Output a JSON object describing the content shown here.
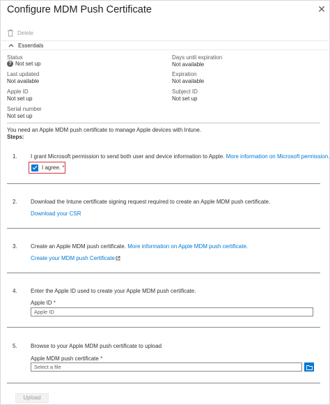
{
  "header": {
    "title": "Configure MDM Push Certificate",
    "close_glyph": "✕"
  },
  "toolbar": {
    "delete_label": "Delete"
  },
  "essentials": {
    "toggle_label": "Essentials",
    "status_label": "Status",
    "status_value": "Not set up",
    "last_updated_label": "Last updated",
    "last_updated_value": "Not available",
    "apple_id_label": "Apple ID",
    "apple_id_value": "Not set up",
    "serial_label": "Serial number",
    "serial_value": "Not set up",
    "days_label": "Days until expiration",
    "days_value": "Not available",
    "expiration_label": "Expiration",
    "expiration_value": "Not available",
    "subject_label": "Subject ID",
    "subject_value": "Not set up"
  },
  "intro": "You need an Apple MDM push certificate to manage Apple devices with Intune.",
  "steps_label": "Steps:",
  "steps": [
    {
      "num": "1.",
      "text": "I grant Microsoft permission to send both user and device information to Apple.",
      "link": "More information on Microsoft permission.",
      "agree_label": "I agree.",
      "required": "*"
    },
    {
      "num": "2.",
      "text": "Download the Intune certificate signing request required to create an Apple MDM push certificate.",
      "link": "Download your CSR"
    },
    {
      "num": "3.",
      "text": "Create an Apple MDM push certificate.",
      "link": "More information on Apple MDM push certificate.",
      "link2": "Create your MDM push Certificate"
    },
    {
      "num": "4.",
      "text": "Enter the Apple ID used to create your Apple MDM push certificate.",
      "field_label": "Apple ID",
      "required": "*",
      "placeholder": "Apple ID"
    },
    {
      "num": "5.",
      "text": "Browse to your Apple MDM push certificate to upload",
      "field_label": "Apple MDM push certificate",
      "required": "*",
      "placeholder": "Select a file"
    }
  ],
  "footer": {
    "upload_label": "Upload"
  },
  "colors": {
    "accent": "#0078d4",
    "required": "#a4262c",
    "highlight_border": "#d13438"
  },
  "icons": {
    "delete": "trash-icon",
    "essentials": "chevron-up-icon",
    "status": "question-icon",
    "external": "external-link-icon",
    "browse": "folder-icon",
    "close": "close-icon"
  }
}
